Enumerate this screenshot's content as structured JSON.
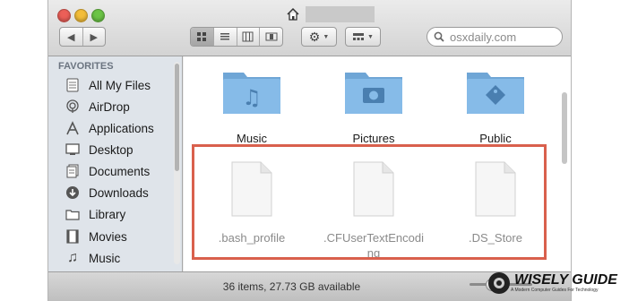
{
  "window": {
    "title": ""
  },
  "toolbar": {
    "back_icon": "chevron-left-icon",
    "forward_icon": "chevron-right-icon",
    "search_placeholder": "osxdaily.com"
  },
  "sidebar": {
    "heading": "FAVORITES",
    "items": [
      {
        "label": "All My Files",
        "icon": "all-files-icon"
      },
      {
        "label": "AirDrop",
        "icon": "airdrop-icon"
      },
      {
        "label": "Applications",
        "icon": "applications-icon"
      },
      {
        "label": "Desktop",
        "icon": "desktop-icon"
      },
      {
        "label": "Documents",
        "icon": "documents-icon"
      },
      {
        "label": "Downloads",
        "icon": "downloads-icon"
      },
      {
        "label": "Library",
        "icon": "folder-icon"
      },
      {
        "label": "Movies",
        "icon": "movies-icon"
      },
      {
        "label": "Music",
        "icon": "music-icon"
      }
    ]
  },
  "content": {
    "folders": [
      {
        "name": "Music",
        "icon": "music-folder-icon"
      },
      {
        "name": "Pictures",
        "icon": "pictures-folder-icon"
      },
      {
        "name": "Public",
        "icon": "public-folder-icon"
      }
    ],
    "hidden_files": [
      {
        "name": ".bash_profile"
      },
      {
        "name": ".CFUserTextEncoding"
      },
      {
        "name": ".DS_Store"
      }
    ]
  },
  "status": {
    "text": "36 items, 27.73 GB available"
  },
  "watermark": {
    "title": "WISELY GUIDE",
    "subtitle": "A Modern Computer Guides For Technology"
  },
  "colors": {
    "highlight": "#d9604d",
    "folder": "#7fb3e0",
    "sidebar_bg": "#dfe4ea"
  }
}
